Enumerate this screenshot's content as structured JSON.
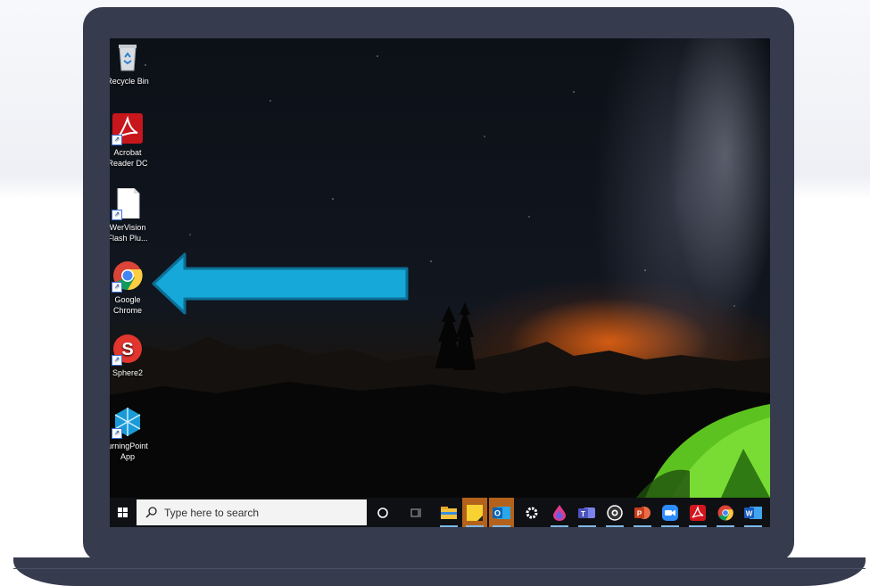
{
  "desktop": {
    "icons": [
      {
        "label": "Recycle Bin"
      },
      {
        "label": "Acrobat Reader DC"
      },
      {
        "label": "WerVision Flash Plu..."
      },
      {
        "label": "Google Chrome"
      },
      {
        "label": "Sphere2"
      },
      {
        "label": "TurningPoint App"
      }
    ],
    "visible_labels": {
      "recycle": "Recycle Bin",
      "acrobat_1": "Acrobat",
      "acrobat_2": "Reader DC",
      "flash_1": "WerVision",
      "flash_2": "Flash Plu...",
      "chrome_1": "Google",
      "chrome_2": "Chrome",
      "sphere": "Sphere2",
      "turning_1": "urningPoint",
      "turning_2": "App"
    }
  },
  "annotation": {
    "arrow_color": "#16a8d8",
    "arrow_border": "#0c6f96",
    "target": "Google Chrome"
  },
  "taskbar": {
    "search_placeholder": "Type here to search",
    "pinned_apps": [
      "cortana",
      "task-view",
      "file-explorer",
      "sticky-notes",
      "outlook",
      "settings",
      "paint-3d",
      "teams",
      "camera",
      "powerpoint",
      "zoom",
      "acrobat",
      "chrome",
      "word"
    ]
  },
  "colors": {
    "frame": "#363c4e",
    "taskbar": "#0f1013",
    "tent": "#6fd22a"
  }
}
